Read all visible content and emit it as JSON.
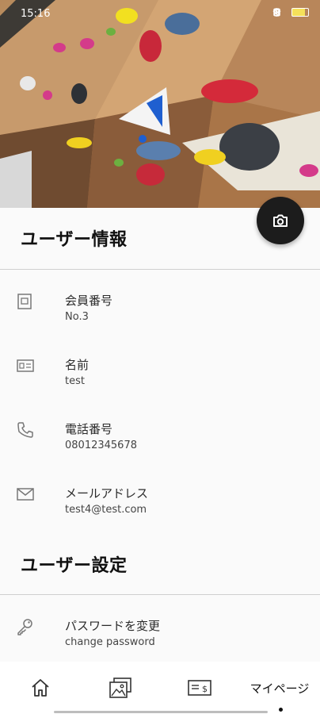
{
  "status_bar": {
    "time": "15:16"
  },
  "user_info": {
    "title": "ユーザー情報",
    "rows": [
      {
        "icon": "id-card-icon",
        "label": "会員番号",
        "value": "No.3"
      },
      {
        "icon": "name-card-icon",
        "label": "名前",
        "value": "test"
      },
      {
        "icon": "phone-icon",
        "label": "電話番号",
        "value": "08012345678"
      },
      {
        "icon": "mail-icon",
        "label": "メールアドレス",
        "value": "test4@test.com"
      }
    ]
  },
  "user_settings": {
    "title": "ユーザー設定",
    "rows": [
      {
        "icon": "key-icon",
        "label": "パスワードを変更",
        "value": "change password"
      }
    ]
  },
  "bottom_nav": {
    "items": [
      {
        "icon": "home-icon",
        "label": ""
      },
      {
        "icon": "gallery-icon",
        "label": ""
      },
      {
        "icon": "ticket-icon",
        "label": ""
      },
      {
        "icon": "",
        "label": "マイページ"
      }
    ],
    "active_index": 3
  }
}
